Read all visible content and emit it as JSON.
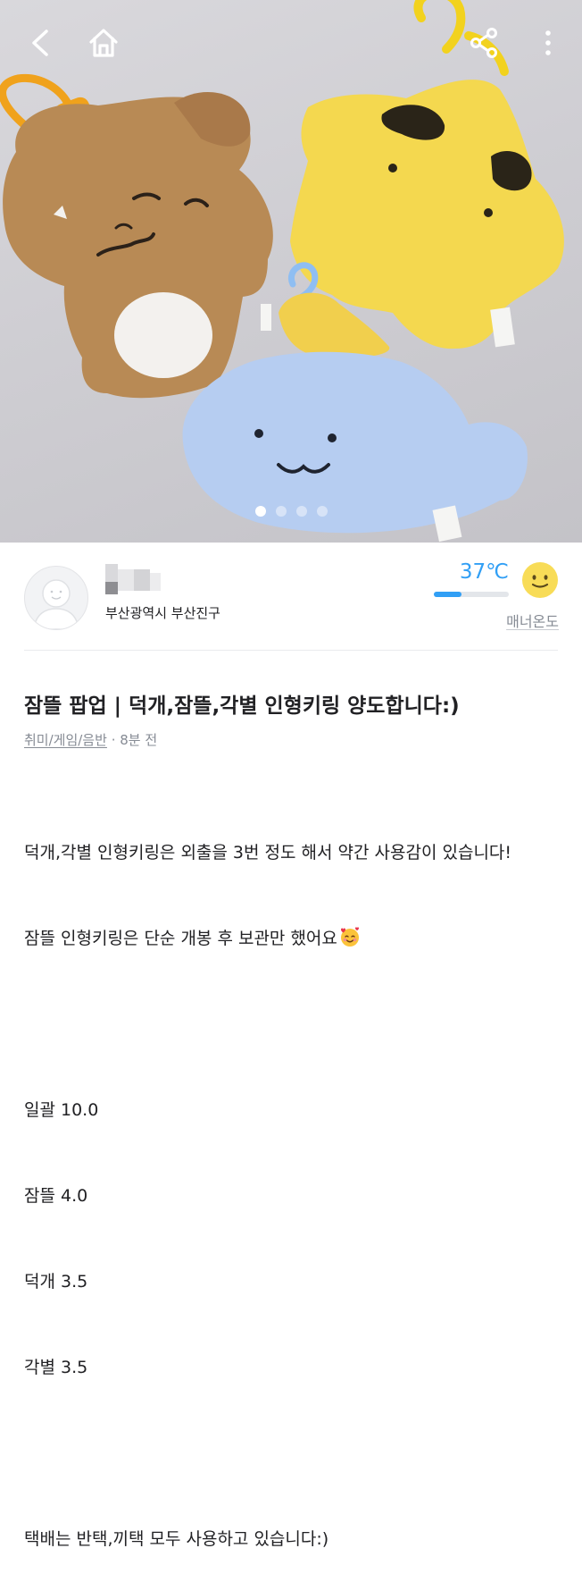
{
  "colors": {
    "accent": "#319ff5",
    "muted": "#868b94",
    "text": "#212124"
  },
  "carousel": {
    "total": 4,
    "active": 1
  },
  "topbar": {
    "icons": [
      "back-arrow-icon",
      "home-icon",
      "share-icon",
      "more-vertical-icon"
    ]
  },
  "seller": {
    "location": "부산광역시 부산진구",
    "temperature": "37℃",
    "temperature_level": 0.37,
    "manner_label": "매너온도"
  },
  "post": {
    "title": "잠뜰 팝업 | 덕개,잠뜰,각별 인형키링 양도합니다:)",
    "category": "취미/게임/음반",
    "time": "8분 전",
    "body_lines": [
      "덕개,각별 인형키링은 외출을 3번 정도 해서 약간 사용감이 있습니다!",
      "잠뜰 인형키링은 단순 개봉 후 보관만 했어요",
      "",
      "일괄 10.0",
      "잠뜰 4.0",
      "덕개 3.5",
      "각별 3.5",
      "",
      "택배는 반택,끼택 모두 사용하고 있습니다:)"
    ]
  }
}
